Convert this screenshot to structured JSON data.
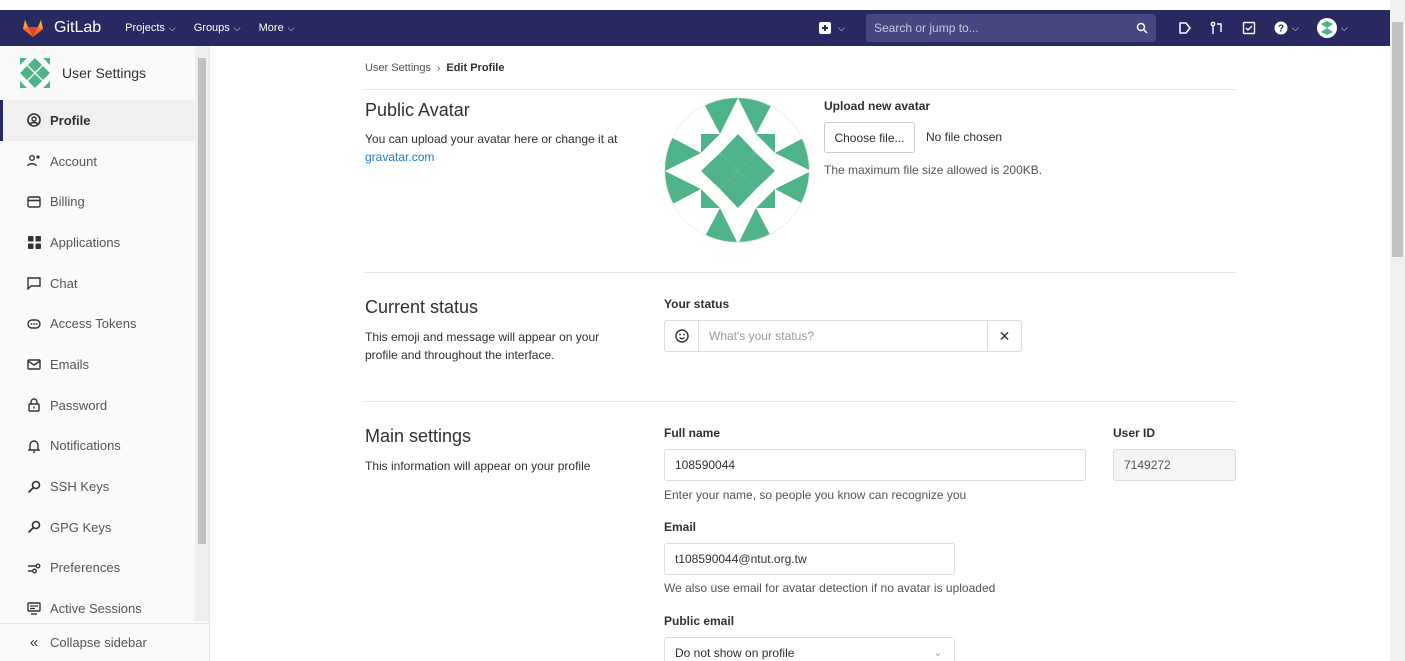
{
  "nav": {
    "brand": "GitLab",
    "items": [
      {
        "label": "Projects"
      },
      {
        "label": "Groups"
      },
      {
        "label": "More"
      }
    ],
    "search_placeholder": "Search or jump to..."
  },
  "sidebar": {
    "title": "User Settings",
    "items": [
      {
        "label": "Profile",
        "icon": "profile-icon"
      },
      {
        "label": "Account",
        "icon": "account-icon"
      },
      {
        "label": "Billing",
        "icon": "billing-icon"
      },
      {
        "label": "Applications",
        "icon": "applications-icon"
      },
      {
        "label": "Chat",
        "icon": "chat-icon"
      },
      {
        "label": "Access Tokens",
        "icon": "access-tokens-icon"
      },
      {
        "label": "Emails",
        "icon": "emails-icon"
      },
      {
        "label": "Password",
        "icon": "password-icon"
      },
      {
        "label": "Notifications",
        "icon": "notifications-icon"
      },
      {
        "label": "SSH Keys",
        "icon": "ssh-keys-icon"
      },
      {
        "label": "GPG Keys",
        "icon": "gpg-keys-icon"
      },
      {
        "label": "Preferences",
        "icon": "preferences-icon"
      },
      {
        "label": "Active Sessions",
        "icon": "active-sessions-icon"
      }
    ],
    "collapse_label": "Collapse sidebar"
  },
  "breadcrumb": {
    "parent": "User Settings",
    "current": "Edit Profile"
  },
  "avatar_section": {
    "title": "Public Avatar",
    "desc": "You can upload your avatar here or change it at",
    "link": "gravatar.com",
    "upload_label": "Upload new avatar",
    "choose_button": "Choose file...",
    "no_file": "No file chosen",
    "max_size_help": "The maximum file size allowed is 200KB."
  },
  "status_section": {
    "title": "Current status",
    "desc": "This emoji and message will appear on your profile and throughout the interface.",
    "label": "Your status",
    "placeholder": "What's your status?"
  },
  "main_section": {
    "title": "Main settings",
    "desc": "This information will appear on your profile",
    "full_name_label": "Full name",
    "full_name_value": "108590044",
    "full_name_help": "Enter your name, so people you know can recognize you",
    "user_id_label": "User ID",
    "user_id_value": "7149272",
    "email_label": "Email",
    "email_value": "t108590044@ntut.org.tw",
    "email_help": "We also use email for avatar detection if no avatar is uploaded",
    "public_email_label": "Public email",
    "public_email_value": "Do not show on profile"
  },
  "colors": {
    "navbar": "#292961",
    "avatar_green": "#4fb38a",
    "link": "#1f78d1"
  }
}
